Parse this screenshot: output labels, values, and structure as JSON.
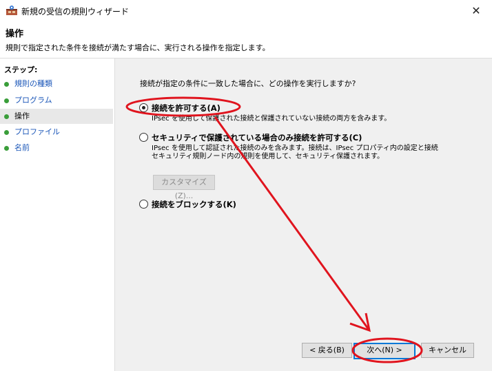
{
  "window": {
    "title": "新規の受信の規則ウィザード",
    "close_glyph": "✕",
    "icon": "firewall-wizard-icon"
  },
  "header": {
    "title": "操作",
    "description": "規則で指定された条件を接続が満たす場合に、実行される操作を指定します。"
  },
  "sidebar": {
    "title": "ステップ:",
    "items": [
      {
        "label": "規則の種類"
      },
      {
        "label": "プログラム"
      },
      {
        "label": "操作"
      },
      {
        "label": "プロファイル"
      },
      {
        "label": "名前"
      }
    ]
  },
  "main": {
    "question": "接続が指定の条件に一致した場合に、どの操作を実行しますか?",
    "options": [
      {
        "label": "接続を許可する(A)",
        "checked": true,
        "desc": [
          "IPsec を使用して保護された接続と保護されていない接続の両方を含みます。"
        ]
      },
      {
        "label": "セキュリティで保護されている場合のみ接続を許可する(C)",
        "checked": false,
        "desc": [
          "IPsec を使用して認証された接続のみを含みます。接続は、IPsec プロパティ内の設定と接続",
          "セキュリティ規則ノード内の規則を使用して、セキュリティ保護されます。"
        ]
      },
      {
        "label": "接続をブロックする(K)",
        "checked": false,
        "desc": []
      }
    ],
    "customize_button": "カスタマイズ(Z)..."
  },
  "footer": {
    "back_button": "< 戻る(B)",
    "next_button": "次へ(N) >",
    "cancel_button": "キャンセル"
  },
  "colors": {
    "annotation": "#e0141e",
    "step_dot": "#3a9e3a",
    "link": "#1a56b8",
    "default_button_border": "#0078d7"
  }
}
